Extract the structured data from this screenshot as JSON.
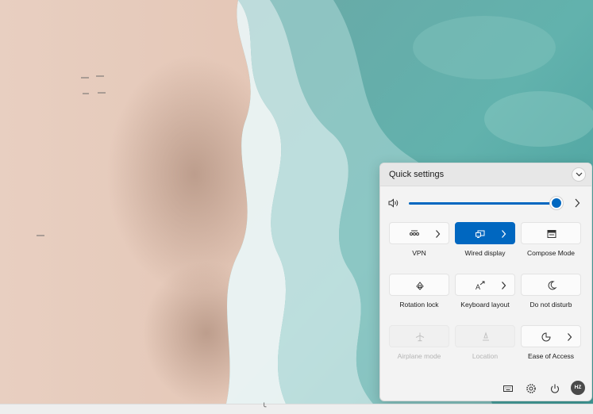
{
  "quick_settings": {
    "title": "Quick settings",
    "volume_level_percent": 97,
    "tiles": [
      {
        "label": "VPN",
        "icon": "vpn-icon",
        "state": "off",
        "has_more": true
      },
      {
        "label": "Wired display",
        "icon": "wired-display-icon",
        "state": "on",
        "has_more": true
      },
      {
        "label": "Compose Mode",
        "icon": "compose-mode-icon",
        "state": "off",
        "has_more": false
      },
      {
        "label": "Rotation lock",
        "icon": "rotation-lock-icon",
        "state": "off",
        "has_more": false
      },
      {
        "label": "Keyboard layout",
        "icon": "keyboard-layout-icon",
        "state": "off",
        "has_more": true
      },
      {
        "label": "Do not disturb",
        "icon": "do-not-disturb-icon",
        "state": "off",
        "has_more": false
      },
      {
        "label": "Airplane mode",
        "icon": "airplane-icon",
        "state": "disabled",
        "has_more": false
      },
      {
        "label": "Location",
        "icon": "location-icon",
        "state": "disabled",
        "has_more": false
      },
      {
        "label": "Ease of Access",
        "icon": "ease-of-access-icon",
        "state": "off",
        "has_more": true
      }
    ],
    "user_initials": "HZ",
    "accent_color": "#0067c0"
  }
}
